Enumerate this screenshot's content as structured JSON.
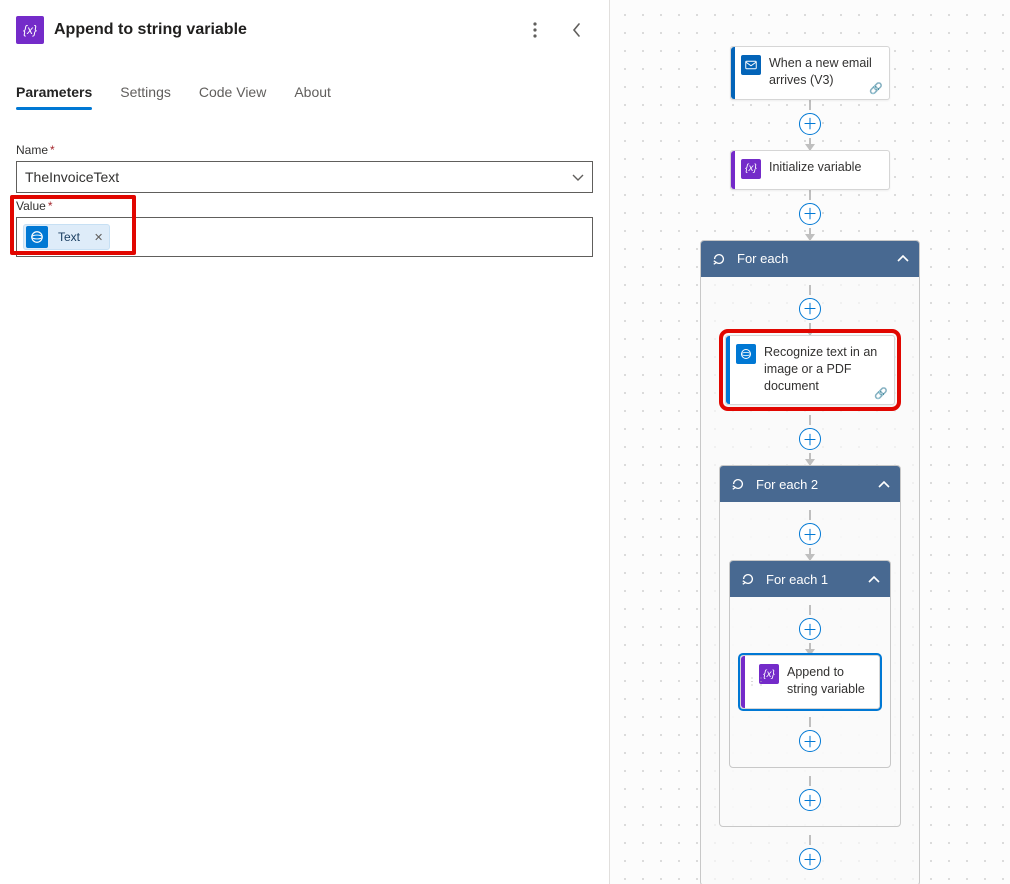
{
  "panel": {
    "title": "Append to string variable",
    "tabs": [
      "Parameters",
      "Settings",
      "Code View",
      "About"
    ],
    "active_tab": 0,
    "fields": {
      "name_label": "Name",
      "name_value": "TheInvoiceText",
      "value_label": "Value",
      "value_token": {
        "label": "Text",
        "source": "cognitive",
        "removable": true
      }
    }
  },
  "flow": {
    "nodes": [
      {
        "id": "email-trigger",
        "title": "When a new email arrives (V3)",
        "icon": "email",
        "accent": "#0364b8",
        "link_indicator": true
      },
      {
        "id": "init-var",
        "title": "Initialize variable",
        "icon": "variable",
        "accent": "#742bc9"
      }
    ],
    "for_each": {
      "title": "For each",
      "recognize": {
        "title": "Recognize text in an image or a PDF document",
        "icon": "cognitive",
        "accent": "#0078d4",
        "highlighted": true,
        "link_indicator": true
      },
      "for_each_2": {
        "title": "For each 2",
        "for_each_1": {
          "title": "For each 1",
          "append": {
            "title": "Append to string variable",
            "icon": "variable",
            "accent": "#742bc9",
            "selected": true
          }
        }
      }
    }
  }
}
